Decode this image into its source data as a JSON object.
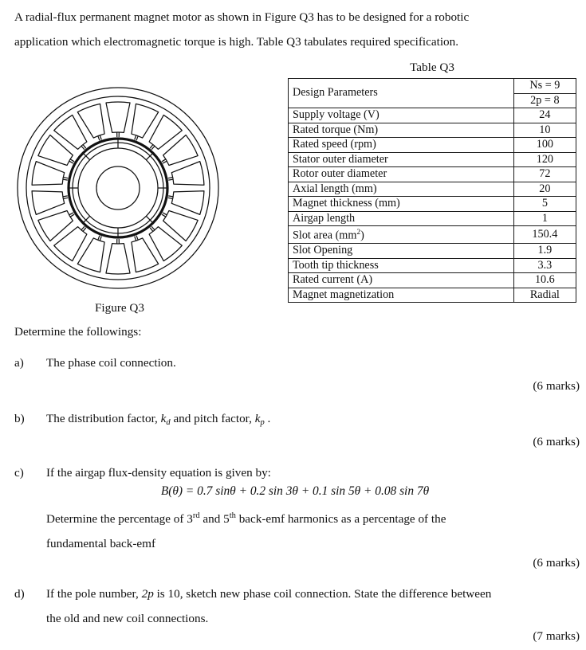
{
  "intro": {
    "line1": "A radial-flux permanent magnet motor as shown in Figure Q3 has to be designed for a robotic",
    "line2": "application which electromagnetic torque is high. Table Q3 tabulates required specification."
  },
  "figure": {
    "caption": "Figure Q3",
    "slot_count": 18,
    "description": "radial-flux permanent magnet motor cross-section"
  },
  "table": {
    "title": "Table Q3",
    "header_label": "Design Parameters",
    "header_value_top": "Ns = 9",
    "header_value_bottom": "2p = 8",
    "rows": [
      {
        "parameter": "Supply voltage (V)",
        "value": "24"
      },
      {
        "parameter": "Rated torque (Nm)",
        "value": "10"
      },
      {
        "parameter": "Rated speed (rpm)",
        "value": "100"
      },
      {
        "parameter": "Stator outer diameter",
        "value": "120"
      },
      {
        "parameter": "Rotor outer diameter",
        "value": "72"
      },
      {
        "parameter": "Axial length (mm)",
        "value": "20"
      },
      {
        "parameter": "Magnet thickness (mm)",
        "value": "5"
      },
      {
        "parameter": "Airgap length",
        "value": "1"
      },
      {
        "parameter": "Slot area (mm2)",
        "value": "150.4"
      },
      {
        "parameter": "Slot Opening",
        "value": "1.9"
      },
      {
        "parameter": "Tooth tip thickness",
        "value": "3.3"
      },
      {
        "parameter": "Rated current (A)",
        "value": "10.6"
      },
      {
        "parameter": "Magnet magnetization",
        "value": "Radial"
      }
    ]
  },
  "questions": {
    "prompt": "Determine the followings:",
    "a": {
      "marker": "a)",
      "text": "The phase coil connection.",
      "marks": "(6 marks)"
    },
    "b": {
      "marker": "b)",
      "text_before": "The distribution factor, ",
      "symbol1": "k",
      "symbol1_sub": "d",
      "text_middle": " and pitch factor, ",
      "symbol2": "k",
      "symbol2_sub": "p",
      "text_after": " .",
      "marks": "(6 marks)"
    },
    "c": {
      "marker": "c)",
      "lead": "If the airgap flux-density equation is given by:",
      "equation": "B(θ) = 0.7 sinθ + 0.2 sin 3θ + 0.1 sin 5θ + 0.08 sin 7θ",
      "body_line1_a": "Determine the percentage of 3",
      "body_ord1": "rd",
      "body_line1_b": " and 5",
      "body_ord2": "th",
      "body_line1_c": " back-emf harmonics as a percentage of the",
      "body_line2": "fundamental back-emf",
      "marks": "(6 marks)"
    },
    "d": {
      "marker": "d)",
      "text_before": "If the pole number, ",
      "symbol": "2p",
      "text_after": " is 10, sketch new phase coil connection. State the difference between",
      "line2": "the old and new coil connections.",
      "marks": "(7 marks)"
    }
  },
  "colors": {
    "ink": "#111111",
    "paper": "#ffffff",
    "rule": "#1a1a1a"
  }
}
